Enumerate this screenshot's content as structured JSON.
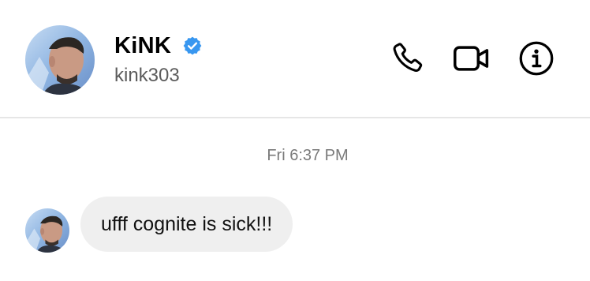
{
  "header": {
    "display_name": "KiNK",
    "handle": "kink303",
    "verified": true,
    "verified_color": "#3897f0",
    "actions": [
      {
        "name": "call",
        "icon": "phone-icon"
      },
      {
        "name": "video-call",
        "icon": "video-camera-icon"
      },
      {
        "name": "info",
        "icon": "info-icon"
      }
    ]
  },
  "conversation": {
    "timestamp": "Fri 6:37 PM",
    "messages": [
      {
        "sender": "kink303",
        "text": "ufff cognite is sick!!!"
      }
    ]
  }
}
